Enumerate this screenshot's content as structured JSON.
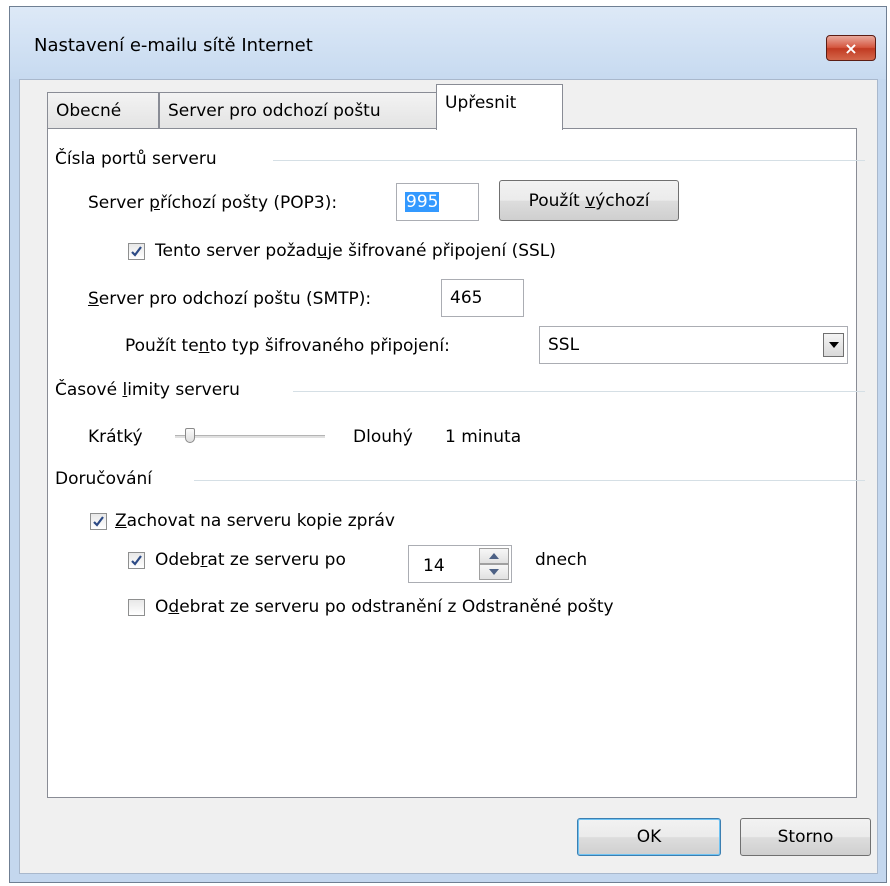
{
  "window": {
    "title": "Nastavení e-mailu sítě Internet",
    "close_symbol": "×"
  },
  "tabs": [
    {
      "label": "Obecné",
      "active": false
    },
    {
      "label": "Server pro odchozí poštu",
      "active": false
    },
    {
      "label": "Upřesnit",
      "active": true
    }
  ],
  "ports": {
    "group_label": "Čísla portů serveru",
    "incoming": {
      "label_a": "Server ",
      "label_u": "p",
      "label_b": "říchozí pošty (POP3):",
      "value": "995"
    },
    "use_default": {
      "label_a": "Použít ",
      "label_u": "v",
      "label_b": "ýchozí"
    },
    "ssl_required": {
      "label_a": "Tento server požad",
      "label_u": "u",
      "label_b": "je šifrované připojení (SSL)",
      "checked": true
    },
    "outgoing": {
      "label_a": "",
      "label_u": "S",
      "label_b": "erver pro odchozí poštu (SMTP):",
      "value": "465"
    },
    "encryption": {
      "label_a": "Použít te",
      "label_u": "n",
      "label_b": "to typ šifrovaného připojení:",
      "value": "SSL"
    }
  },
  "timeouts": {
    "group_label_a": "Časové ",
    "group_label_u": "l",
    "group_label_b": "imity serveru",
    "short_label": "Krátký",
    "long_label": "Dlouhý",
    "value_text": "1 minuta",
    "slider_level": 0.07
  },
  "delivery": {
    "group_label": "Doručování",
    "keep_copy": {
      "label_a": "",
      "label_u": "Z",
      "label_b": "achovat na serveru kopie zpráv",
      "checked": true
    },
    "remove_after": {
      "label_a": "Odeb",
      "label_u": "r",
      "label_b": "at ze serveru po",
      "checked": true,
      "days": "14",
      "unit": "dnech"
    },
    "remove_deleted": {
      "label_a": "O",
      "label_u": "d",
      "label_b": "ebrat ze serveru po odstranění z Odstraněné pošty",
      "checked": false
    }
  },
  "footer": {
    "ok": "OK",
    "cancel": "Storno"
  },
  "colors": {
    "checkmark": "#2c4a85",
    "selection": "#3399ff",
    "close_button": "#c94a32"
  }
}
